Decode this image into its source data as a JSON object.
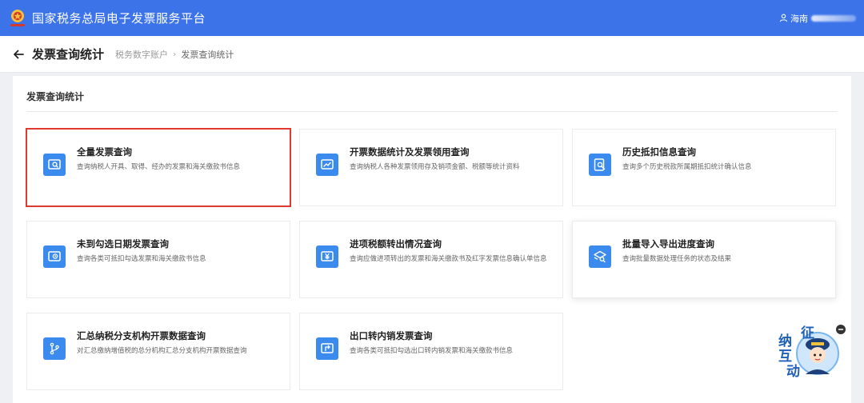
{
  "header": {
    "app_title": "国家税务总局电子发票服务平台",
    "user_prefix": "海南"
  },
  "page": {
    "title": "发票查询统计",
    "breadcrumb": [
      "税务数字账户",
      "发票查询统计"
    ]
  },
  "section": {
    "title": "发票查询统计"
  },
  "cards": [
    {
      "title": "全量发票查询",
      "desc": "查询纳税人开具、取得、经办的发票和海关缴款书信息",
      "icon": "invoice-search-icon"
    },
    {
      "title": "开票数据统计及发票领用查询",
      "desc": "查询纳税人各种发票领用存及销项金额、税额等统计资料",
      "icon": "invoice-chart-icon"
    },
    {
      "title": "历史抵扣信息查询",
      "desc": "查询多个历史税款所属期抵扣统计确认信息",
      "icon": "history-search-icon"
    },
    {
      "title": "未到勾选日期发票查询",
      "desc": "查询各类可抵扣勾选发票和海关缴款书信息",
      "icon": "invoice-clock-icon"
    },
    {
      "title": "进项税额转出情况查询",
      "desc": "查询应做进项转出的发票和海关缴款书及红字发票信息确认单信息",
      "icon": "invoice-yen-icon"
    },
    {
      "title": "批量导入导出进度查询",
      "desc": "查询批量数据处理任务的状态及结果",
      "icon": "batch-progress-icon"
    },
    {
      "title": "汇总纳税分支机构开票数据查询",
      "desc": "对汇总缴纳增值税的总分机构汇总分支机构开票数据查询",
      "icon": "branch-icon"
    },
    {
      "title": "出口转内销发票查询",
      "desc": "查询各类可抵扣勾选出口转内销发票和海关缴款书信息",
      "icon": "export-invoice-icon"
    }
  ],
  "mascot": {
    "chars": [
      "征",
      "纳",
      "互",
      "动"
    ]
  },
  "colors": {
    "brand": "#3c73e9",
    "icon_bg": "#3a8bed",
    "highlight": "#e03a2f"
  }
}
